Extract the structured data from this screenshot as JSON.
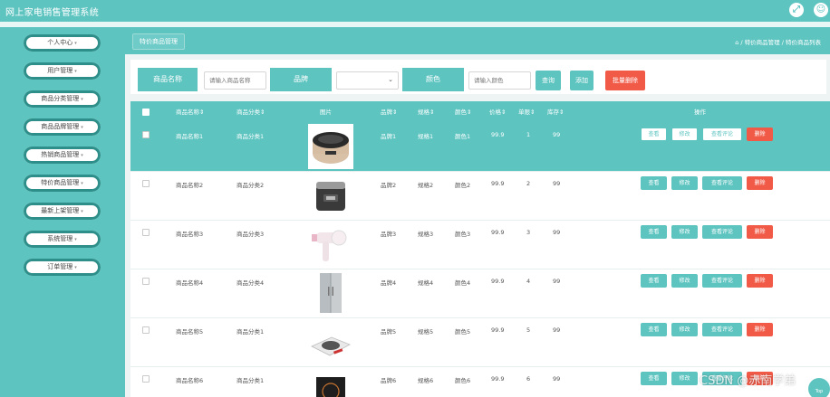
{
  "app": {
    "title": "网上家电销售管理系统"
  },
  "header_icons": {
    "fullscreen": "fullscreen-icon",
    "user": "user-icon"
  },
  "sidebar": {
    "items": [
      {
        "label": "个人中心"
      },
      {
        "label": "用户管理"
      },
      {
        "label": "商品分类管理"
      },
      {
        "label": "商品品牌管理"
      },
      {
        "label": "热销商品管理"
      },
      {
        "label": "特价商品管理"
      },
      {
        "label": "最新上架管理"
      },
      {
        "label": "系统管理"
      },
      {
        "label": "订单管理"
      }
    ],
    "caret": "▾"
  },
  "breadcrumb": {
    "tab": "特价商品管理",
    "home_icon": "⌂",
    "path": "/ 特价商品管理 / 特价商品列表"
  },
  "search": {
    "name_label": "商品名称",
    "name_placeholder": "请输入商品名称",
    "brand_label": "品牌",
    "brand_value": "",
    "color_label": "颜色",
    "color_placeholder": "请输入颜色",
    "query_btn": "查询",
    "add_btn": "添加",
    "batch_delete_btn": "批量删除"
  },
  "table": {
    "headers": {
      "name": "商品名称⇕",
      "category": "商品分类⇕",
      "image": "图片",
      "brand": "品牌⇕",
      "spec": "规格⇕",
      "color": "颜色⇕",
      "price": "价格⇕",
      "clicks": "单限⇕",
      "stock": "库存⇕",
      "actions": "操作"
    },
    "rows": [
      {
        "name": "商品名称1",
        "category": "商品分类1",
        "image": "rice-cooker",
        "brand": "品牌1",
        "spec": "规格1",
        "color": "颜色1",
        "price": "99.9",
        "limit": "1",
        "stock": "99"
      },
      {
        "name": "商品名称2",
        "category": "商品分类2",
        "image": "pressure-cooker",
        "brand": "品牌2",
        "spec": "规格2",
        "color": "颜色2",
        "price": "99.9",
        "limit": "2",
        "stock": "99"
      },
      {
        "name": "商品名称3",
        "category": "商品分类3",
        "image": "hair-dryer",
        "brand": "品牌3",
        "spec": "规格3",
        "color": "颜色3",
        "price": "99.9",
        "limit": "3",
        "stock": "99"
      },
      {
        "name": "商品名称4",
        "category": "商品分类4",
        "image": "refrigerator",
        "brand": "品牌4",
        "spec": "规格4",
        "color": "颜色4",
        "price": "99.9",
        "limit": "4",
        "stock": "99"
      },
      {
        "name": "商品名称5",
        "category": "商品分类1",
        "image": "induction-cooker",
        "brand": "品牌5",
        "spec": "规格5",
        "color": "颜色5",
        "price": "99.9",
        "limit": "5",
        "stock": "99"
      },
      {
        "name": "商品名称6",
        "category": "商品分类1",
        "image": "cooktop",
        "brand": "品牌6",
        "spec": "规格6",
        "color": "颜色6",
        "price": "99.9",
        "limit": "6",
        "stock": "99"
      }
    ],
    "action_labels": {
      "view": "查看",
      "edit": "修改",
      "reviews": "查看评论",
      "delete": "删除"
    }
  },
  "watermark": "CSDN @赤南学弟",
  "back_to_top": "Top",
  "colors": {
    "accent": "#5ec4c0",
    "danger": "#f15a47",
    "sidebar_ring": "#2e8f8a"
  }
}
